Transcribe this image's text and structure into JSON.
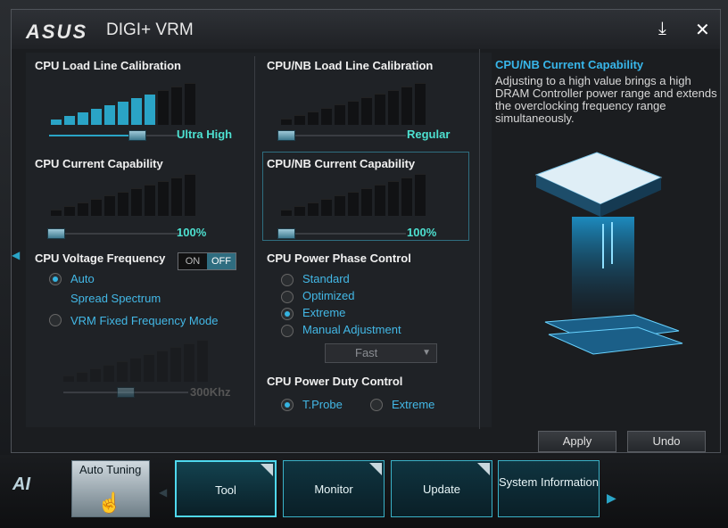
{
  "app": {
    "brand": "ASUS",
    "title": "DIGI+ VRM"
  },
  "window_controls": {
    "minimize_icon": "download-arrow-icon",
    "close_icon": "close-icon"
  },
  "left_col": {
    "cpu_llc": {
      "title": "CPU Load Line Calibration",
      "value": "Ultra High",
      "level": 0.62
    },
    "cpu_cc": {
      "title": "CPU Current Capability",
      "value": "100%",
      "level": 0.0
    },
    "cpu_vf": {
      "title": "CPU Voltage Frequency",
      "auto": "Auto",
      "spread": "Spread Spectrum",
      "toggle_on": "ON",
      "toggle_off": "OFF",
      "fixed": "VRM Fixed Frequency Mode",
      "freq_value": "300Khz"
    }
  },
  "mid_col": {
    "nb_llc": {
      "title": "CPU/NB Load Line Calibration",
      "value": "Regular",
      "level": 0.0
    },
    "nb_cc": {
      "title": "CPU/NB Current Capability",
      "value": "100%",
      "level": 0.0
    },
    "phase": {
      "title": "CPU Power Phase Control",
      "options": [
        "Standard",
        "Optimized",
        "Extreme",
        "Manual Adjustment"
      ],
      "selected": "Extreme",
      "manual_select": "Fast"
    },
    "duty": {
      "title": "CPU Power Duty Control",
      "options": [
        "T.Probe",
        "Extreme"
      ],
      "selected": "T.Probe"
    }
  },
  "info": {
    "title": "CPU/NB Current Capability",
    "text": "Adjusting to a high value brings a high DRAM Controller power range and extends the overclocking frequency range simultaneously."
  },
  "buttons": {
    "apply": "Apply",
    "undo": "Undo"
  },
  "nav": {
    "auto_tuning": "Auto Tuning",
    "tool": "Tool",
    "monitor": "Monitor",
    "update": "Update",
    "sysinfo": "System Information"
  },
  "colors": {
    "accent": "#2aa4c6",
    "value": "#4de0d0",
    "link": "#43b8e6"
  }
}
